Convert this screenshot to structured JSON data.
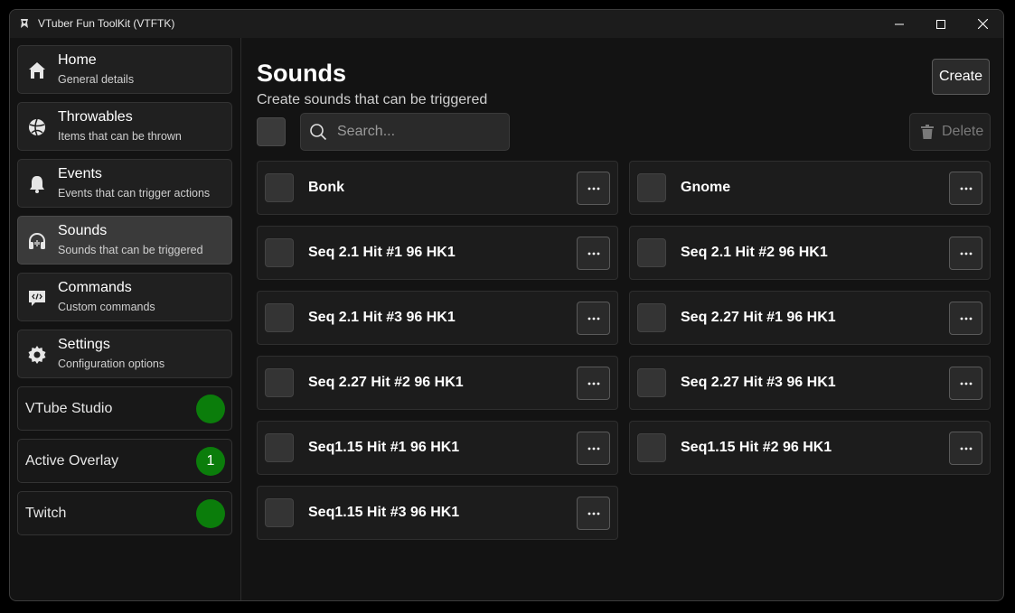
{
  "window": {
    "title": "VTuber Fun ToolKit (VTFTK)"
  },
  "sidebar": {
    "items": [
      {
        "label": "Home",
        "subtitle": "General details",
        "icon": "home-icon"
      },
      {
        "label": "Throwables",
        "subtitle": "Items that can be thrown",
        "icon": "ball-icon"
      },
      {
        "label": "Events",
        "subtitle": "Events that can trigger actions",
        "icon": "bell-icon"
      },
      {
        "label": "Sounds",
        "subtitle": "Sounds that can be triggered",
        "icon": "headphones-icon",
        "active": true
      },
      {
        "label": "Commands",
        "subtitle": "Custom commands",
        "icon": "code-bubble-icon"
      },
      {
        "label": "Settings",
        "subtitle": "Configuration options",
        "icon": "gear-icon"
      }
    ],
    "status": [
      {
        "label": "VTube Studio",
        "value": "",
        "color": "#0b7d0b"
      },
      {
        "label": "Active Overlay",
        "value": "1",
        "color": "#0b7d0b"
      },
      {
        "label": "Twitch",
        "value": "",
        "color": "#0b7d0b"
      }
    ]
  },
  "main": {
    "title": "Sounds",
    "subtitle": "Create sounds that can be triggered",
    "create_label": "Create",
    "search_placeholder": "Search...",
    "delete_label": "Delete",
    "sounds": [
      "Bonk",
      "Gnome",
      "Seq 2.1 Hit #1 96 HK1",
      "Seq 2.1 Hit #2 96 HK1",
      "Seq 2.1 Hit #3 96 HK1",
      "Seq 2.27 Hit #1 96 HK1",
      "Seq 2.27 Hit #2 96 HK1",
      "Seq 2.27 Hit #3 96 HK1",
      "Seq1.15 Hit #1 96 HK1",
      "Seq1.15 Hit #2 96 HK1",
      "Seq1.15 Hit #3 96 HK1"
    ]
  }
}
